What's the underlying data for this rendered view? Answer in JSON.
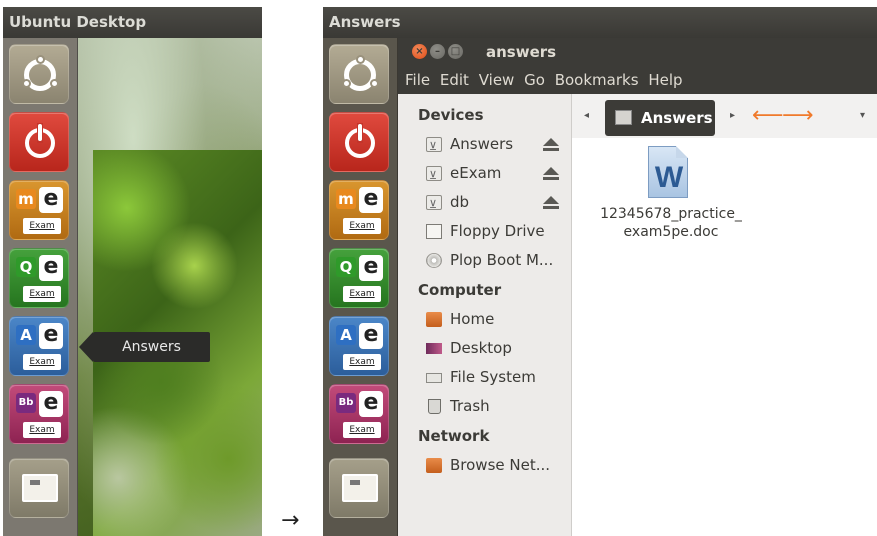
{
  "left_screen": {
    "topbar_title": "Ubuntu Desktop",
    "tooltip_text": "Answers",
    "launcher": [
      {
        "name": "ubuntu-dash-button"
      },
      {
        "name": "power-button"
      },
      {
        "name": "exam-m-button",
        "letter": "m",
        "word": "Exam"
      },
      {
        "name": "exam-q-button",
        "letter": "Q",
        "word": "Exam"
      },
      {
        "name": "exam-a-button",
        "letter": "A",
        "word": "Exam"
      },
      {
        "name": "exam-bb-button",
        "letter": "Bb",
        "word": "Exam"
      },
      {
        "name": "files-button"
      }
    ],
    "exam_e": "e"
  },
  "transition_arrow": "→",
  "right_screen": {
    "topbar_title": "Answers",
    "window_title": "answers",
    "menu": [
      "File",
      "Edit",
      "View",
      "Go",
      "Bookmarks",
      "Help"
    ],
    "sidebar": {
      "devices_heading": "Devices",
      "devices": [
        "Answers",
        "eExam",
        "db",
        "Floppy Drive",
        "Plop Boot M..."
      ],
      "computer_heading": "Computer",
      "computer": [
        "Home",
        "Desktop",
        "File System",
        "Trash"
      ],
      "network_heading": "Network",
      "network": [
        "Browse Net..."
      ]
    },
    "breadcrumb": "Answers",
    "file": {
      "icon_letter": "W",
      "name_line1": "12345678_practice_",
      "name_line2": "exam5pe.doc"
    }
  }
}
